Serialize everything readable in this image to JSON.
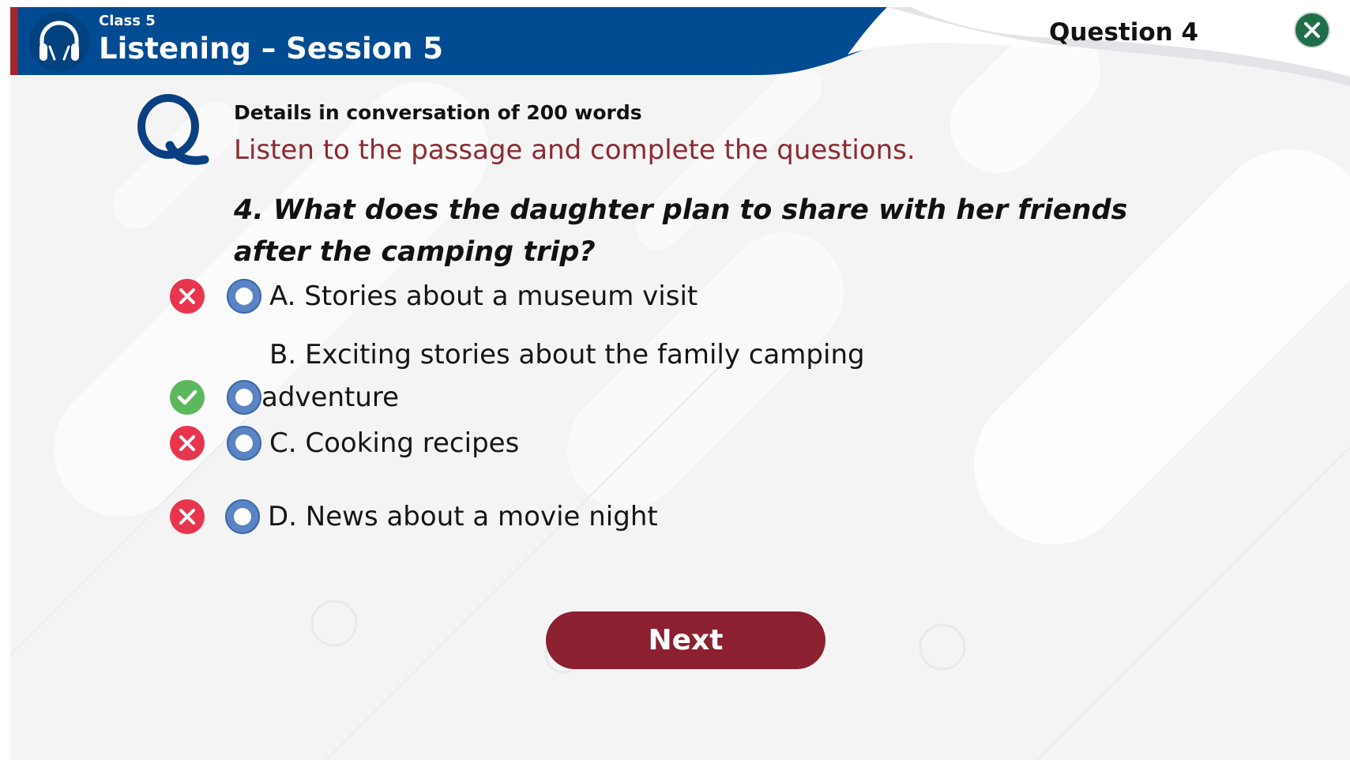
{
  "header": {
    "class_label": "Class 5",
    "session_title": "Listening – Session 5",
    "question_number": "Question 4",
    "headphones_icon": "headphones-icon",
    "close_icon": "close-icon"
  },
  "question": {
    "q_icon": "letter-q-icon",
    "subtitle": "Details in conversation of 200 words",
    "instruction": "Listen to the passage and complete the questions.",
    "text": "4. What does the daughter plan to share with her friends after the camping trip?",
    "options": [
      {
        "label": "A. Stories about a museum visit",
        "status": "incorrect"
      },
      {
        "label_line1": "B. Exciting stories about the family camping",
        "label_line2": "adventure",
        "status": "correct"
      },
      {
        "label": "C. Cooking recipes",
        "status": "incorrect"
      },
      {
        "label": "D. News about a movie night",
        "status": "incorrect"
      }
    ]
  },
  "next_label": "Next",
  "colors": {
    "header_blue": "#014b92",
    "accent_red": "#8b2030",
    "instruction_red": "#8e2a31",
    "correct_green": "#5cb85c",
    "incorrect_red": "#e8354f",
    "radio_blue": "#5b84c4",
    "close_green": "#1f6e4a"
  }
}
